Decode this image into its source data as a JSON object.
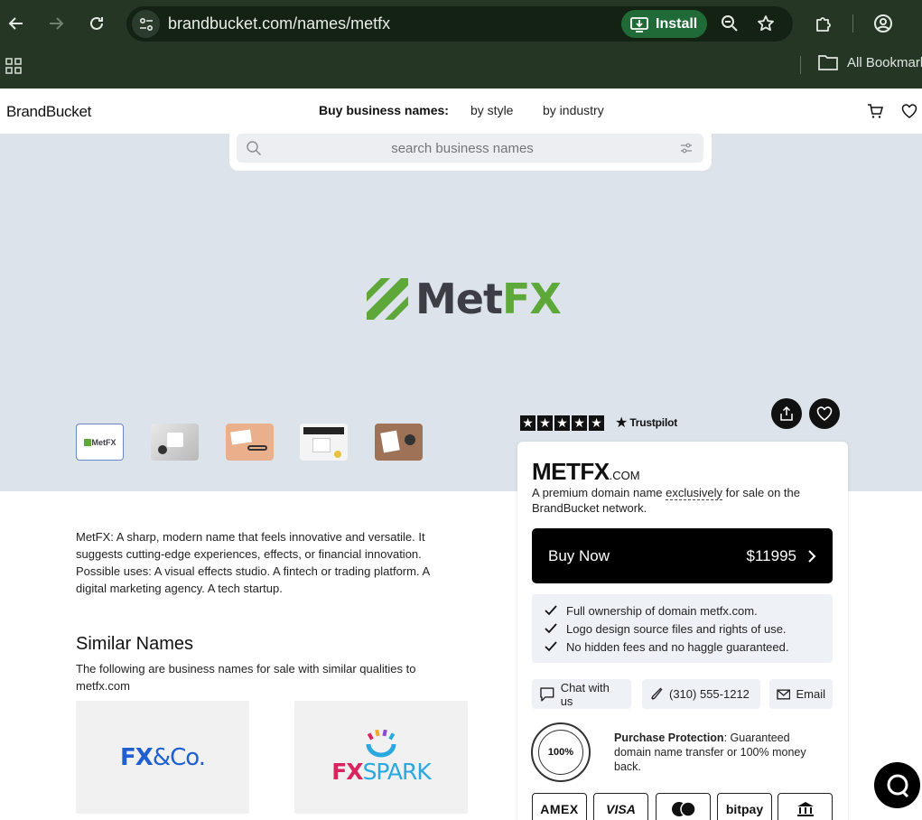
{
  "browser": {
    "url": "brandbucket.com/names/metfx",
    "install_label": "Install",
    "bookmarks_folder": "All Bookmarks"
  },
  "header": {
    "logo": "BrandBucket",
    "buy_label": "Buy business names:",
    "nav": [
      "by style",
      "by industry"
    ]
  },
  "search": {
    "placeholder": "search business names"
  },
  "hero": {
    "brand_part1": "Met",
    "brand_part2": "FX",
    "brand_color_dark": "#3d3d45",
    "brand_color_green": "#5ea83a",
    "thumb_mini": "MetFX"
  },
  "sidebar": {
    "trustpilot": "Trustpilot",
    "domain": "METFX",
    "tld": ".COM",
    "desc_before": "A premium domain name ",
    "desc_em": "exclusively",
    "desc_after": " for sale on the BrandBucket network.",
    "buy_label": "Buy Now",
    "price": "$11995",
    "benefits": [
      "Full ownership of domain metfx.com.",
      "Logo design source files and rights of use.",
      "No hidden fees and no haggle guaranteed."
    ],
    "chat": "Chat with us",
    "phone": "(310) 555-1212",
    "email": "Email",
    "seal_text": "100%",
    "protect_title": "Purchase Protection",
    "protect_text": ": Guaranteed domain name transfer or 100% money back.",
    "payments": [
      "AMEX",
      "VISA",
      "mastercard",
      "bitpay",
      "bank"
    ]
  },
  "main": {
    "description": "MetFX: A sharp, modern name that feels innovative and versatile. It suggests cutting-edge experiences, effects, or financial innovation. Possible uses: A visual effects studio. A fintech or trading platform. A digital marketing agency. A tech startup.",
    "similar_title": "Similar Names",
    "similar_desc": "The following are business names for sale with similar qualities to metfx.com",
    "similar": [
      {
        "part1": "FX",
        "part2": "&Co.",
        "color": "#1f5fd1"
      },
      {
        "part1": "FX",
        "part2": "SPARK",
        "color1": "#d9245f",
        "color2": "#2aa8e0"
      }
    ]
  }
}
